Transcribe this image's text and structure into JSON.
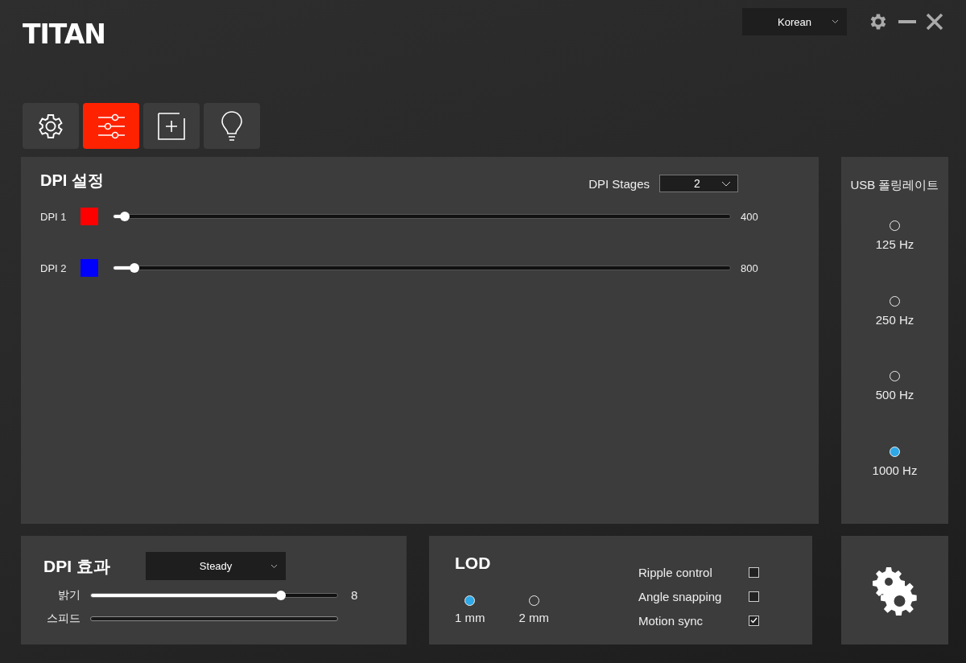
{
  "logo": "TITAN",
  "language": {
    "value": "Korean"
  },
  "tabs": [
    {
      "kind": "gear",
      "selected": false
    },
    {
      "kind": "sliders",
      "selected": true
    },
    {
      "kind": "plus",
      "selected": false
    },
    {
      "kind": "bulb",
      "selected": false
    }
  ],
  "dpi": {
    "title": "DPI 설정",
    "stages_label": "DPI Stages",
    "stages_value": "2",
    "rows": [
      {
        "label": "DPI 1",
        "color": "#ff0000",
        "level": 0.018,
        "value": "400"
      },
      {
        "label": "DPI 2",
        "color": "#0000ff",
        "level": 0.034,
        "value": "800"
      }
    ]
  },
  "polling": {
    "title": "USB 폴링레이트",
    "options": [
      {
        "label": "125 Hz",
        "selected": false
      },
      {
        "label": "250 Hz",
        "selected": false
      },
      {
        "label": "500 Hz",
        "selected": false
      },
      {
        "label": "1000 Hz",
        "selected": true
      }
    ]
  },
  "effect": {
    "title": "DPI 효과",
    "mode": "Steady",
    "sliders": [
      {
        "label": "밝기",
        "disabled": false,
        "level": 0.77,
        "value": "8"
      },
      {
        "label": "스피드",
        "disabled": true
      }
    ]
  },
  "lod": {
    "title": "LOD",
    "options": [
      {
        "label": "1 mm",
        "selected": true
      },
      {
        "label": "2 mm",
        "selected": false
      }
    ],
    "toggles": [
      {
        "label": "Ripple control",
        "checked": false
      },
      {
        "label": "Angle snapping",
        "checked": false
      },
      {
        "label": "Motion sync",
        "checked": true
      }
    ]
  }
}
